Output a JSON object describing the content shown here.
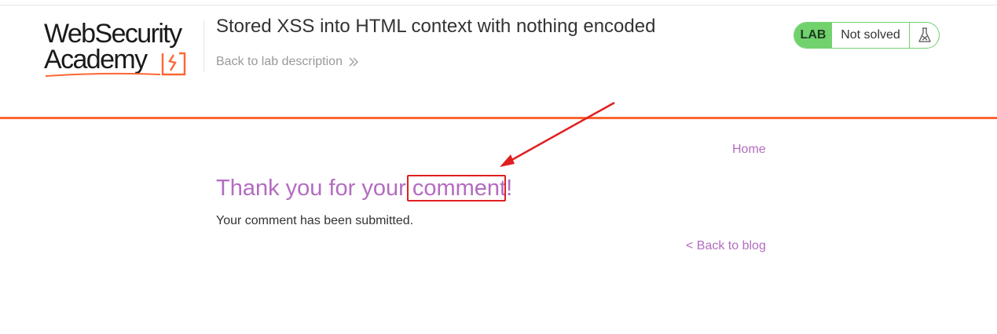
{
  "header": {
    "logo_line1": "WebSecurity",
    "logo_line2": "Academy",
    "lab_title": "Stored XSS into HTML context with nothing encoded",
    "back_to_description": "Back to lab description",
    "status_badge": {
      "lab_label": "LAB",
      "state": "Not solved",
      "icon": "flask-icon"
    }
  },
  "nav": {
    "home_label": "Home"
  },
  "main": {
    "heading": "Thank you for your comment!",
    "message": "Your comment has been submitted.",
    "back_to_blog": "< Back to blog"
  },
  "colors": {
    "accent_orange": "#ff6633",
    "link_purple": "#b36cc0",
    "lab_green": "#70d16d",
    "annotation_red": "#e02020"
  }
}
